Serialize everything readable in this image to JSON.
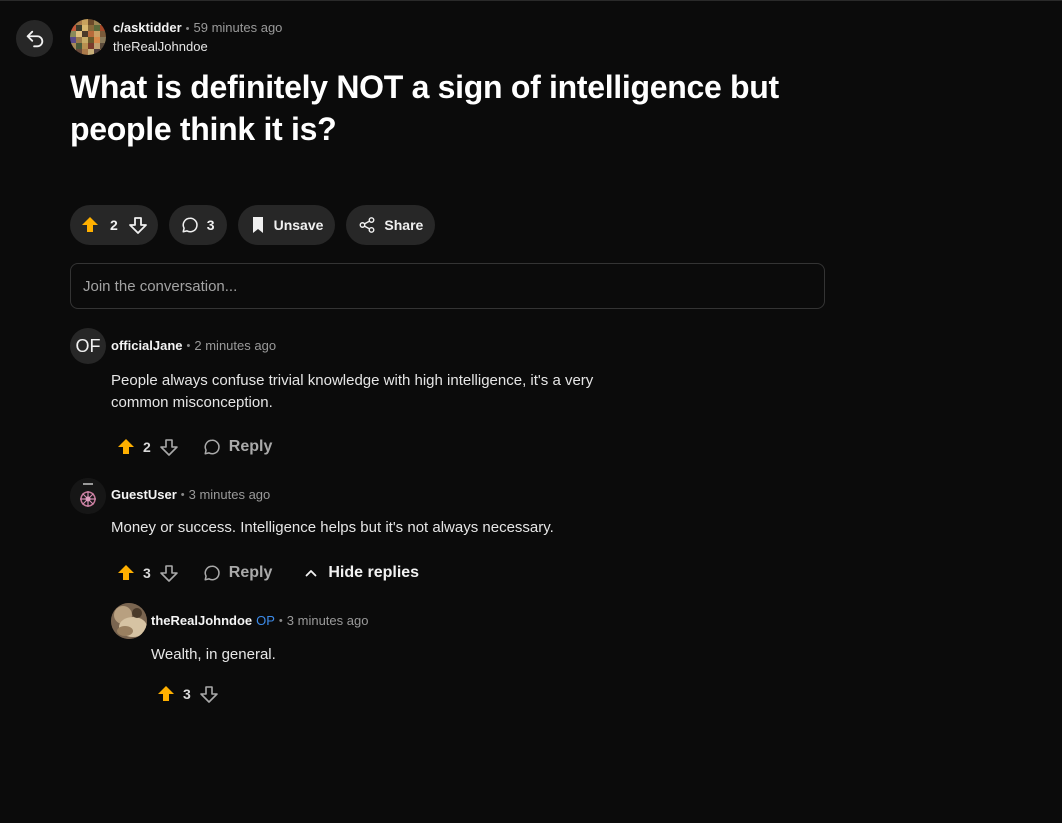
{
  "post": {
    "subreddit": "c/asktidder",
    "time": "59 minutes ago",
    "author": "theRealJohndoe",
    "title": "What is definitely NOT a sign of intelligence but people think it is?",
    "vote_count": "2",
    "comment_count": "3",
    "unsave_label": "Unsave",
    "share_label": "Share"
  },
  "composer": {
    "placeholder": "Join the conversation..."
  },
  "comments": [
    {
      "initials": "OF",
      "user": "officialJane",
      "time": "2 minutes ago",
      "body": "People always confuse trivial knowledge with high intelligence, it's a very common misconception.",
      "votes": "2",
      "reply_label": "Reply"
    },
    {
      "user": "GuestUser",
      "time": "3 minutes ago",
      "body": "Money or success. Intelligence helps but it's not always necessary.",
      "votes": "3",
      "reply_label": "Reply",
      "hide_replies_label": "Hide replies"
    },
    {
      "user": "theRealJohndoe",
      "op_badge": "OP",
      "time": "3 minutes ago",
      "body": "Wealth, in general.",
      "votes": "3"
    }
  ],
  "colors": {
    "background": "#0b0b0b",
    "pill": "#272727",
    "upvote_active": "#ffb000",
    "op_badge": "#3d8be8"
  },
  "icons": [
    "back-icon",
    "upvote-icon",
    "downvote-icon",
    "comment-icon",
    "bookmark-icon",
    "share-icon",
    "chevron-up-icon"
  ]
}
